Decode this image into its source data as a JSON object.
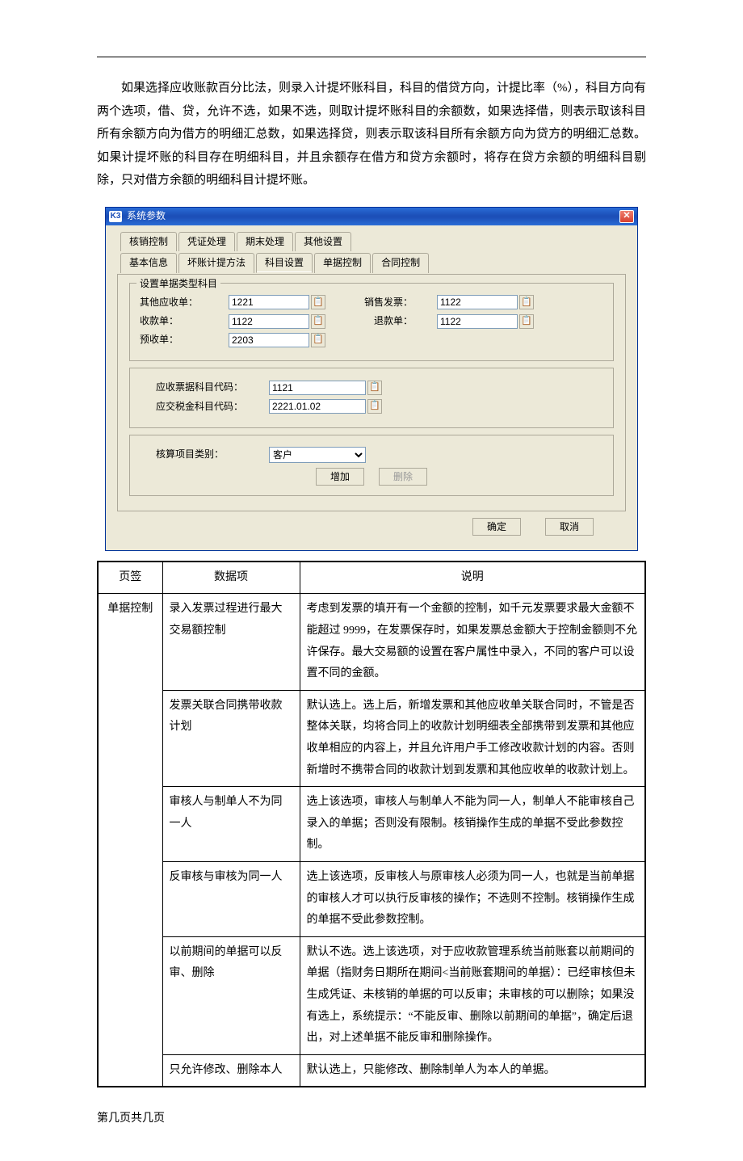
{
  "top_paragraph": "如果选择应收账款百分比法，则录入计提坏账科目，科目的借贷方向，计提比率（%），科目方向有两个选项，借、贷，允许不选，如果不选，则取计提坏账科目的余额数，如果选择借，则表示取该科目所有余额方向为借方的明细汇总数，如果选择贷，则表示取该科目所有余额方向为贷方的明细汇总数。如果计提坏账的科目存在明细科目，并且余额存在借方和贷方余额时，将存在贷方余额的明细科目剔除，只对借方余额的明细科目计提坏账。",
  "dialog": {
    "title": "系统参数",
    "main_tabs": [
      "核销控制",
      "凭证处理",
      "期末处理",
      "其他设置"
    ],
    "sub_tabs": [
      "基本信息",
      "坏账计提方法",
      "科目设置",
      "单据控制",
      "合同控制"
    ],
    "active_sub_tab_index": 2,
    "group1_legend": "设置单据类型科目",
    "fields": {
      "other_receivable_label": "其他应收单：",
      "other_receivable_value": "1221",
      "sales_invoice_label": "销售发票：",
      "sales_invoice_value": "1122",
      "receipt_label": "收款单：",
      "receipt_value": "1122",
      "refund_label": "退款单：",
      "refund_value": "1122",
      "advance_label": "预收单：",
      "advance_value": "2203",
      "ar_acct_label": "应收票据科目代码：",
      "ar_acct_value": "1121",
      "tax_acct_label": "应交税金科目代码：",
      "tax_acct_value": "2221.01.02",
      "category_label": "核算项目类别：",
      "category_value": "客户"
    },
    "buttons": {
      "add": "增加",
      "delete": "删除",
      "ok": "确定",
      "cancel": "取消"
    }
  },
  "table": {
    "headers": [
      "页签",
      "数据项",
      "说明"
    ],
    "tab_label": "单据控制",
    "rows": [
      {
        "item": "录入发票过程进行最大交易额控制",
        "desc": "考虑到发票的填开有一个金额的控制，如千元发票要求最大金额不能超过 9999，在发票保存时，如果发票总金额大于控制金额则不允许保存。最大交易额的设置在客户属性中录入，不同的客户可以设置不同的金额。"
      },
      {
        "item": "发票关联合同携带收款计划",
        "desc": "默认选上。选上后，新增发票和其他应收单关联合同时，不管是否整体关联，均将合同上的收款计划明细表全部携带到发票和其他应收单相应的内容上，并且允许用户手工修改收款计划的内容。否则新增时不携带合同的收款计划到发票和其他应收单的收款计划上。"
      },
      {
        "item": "审核人与制单人不为同一人",
        "desc": "选上该选项，审核人与制单人不能为同一人，制单人不能审核自己录入的单据；否则没有限制。核销操作生成的单据不受此参数控制。"
      },
      {
        "item": "反审核与审核为同一人",
        "desc": "选上该选项，反审核人与原审核人必须为同一人，也就是当前单据的审核人才可以执行反审核的操作；不选则不控制。核销操作生成的单据不受此参数控制。"
      },
      {
        "item": "以前期间的单据可以反审、删除",
        "desc": "默认不选。选上该选项，对于应收款管理系统当前账套以前期间的单据（指财务日期所在期间<当前账套期间的单据）：已经审核但未生成凭证、未核销的单据的可以反审；未审核的可以删除；如果没有选上，系统提示：“不能反审、删除以前期间的单据”，确定后退出，对上述单据不能反审和删除操作。"
      },
      {
        "item": "只允许修改、删除本人",
        "desc": "默认选上，只能修改、删除制单人为本人的单据。"
      }
    ]
  },
  "footer": "第几页共几页"
}
